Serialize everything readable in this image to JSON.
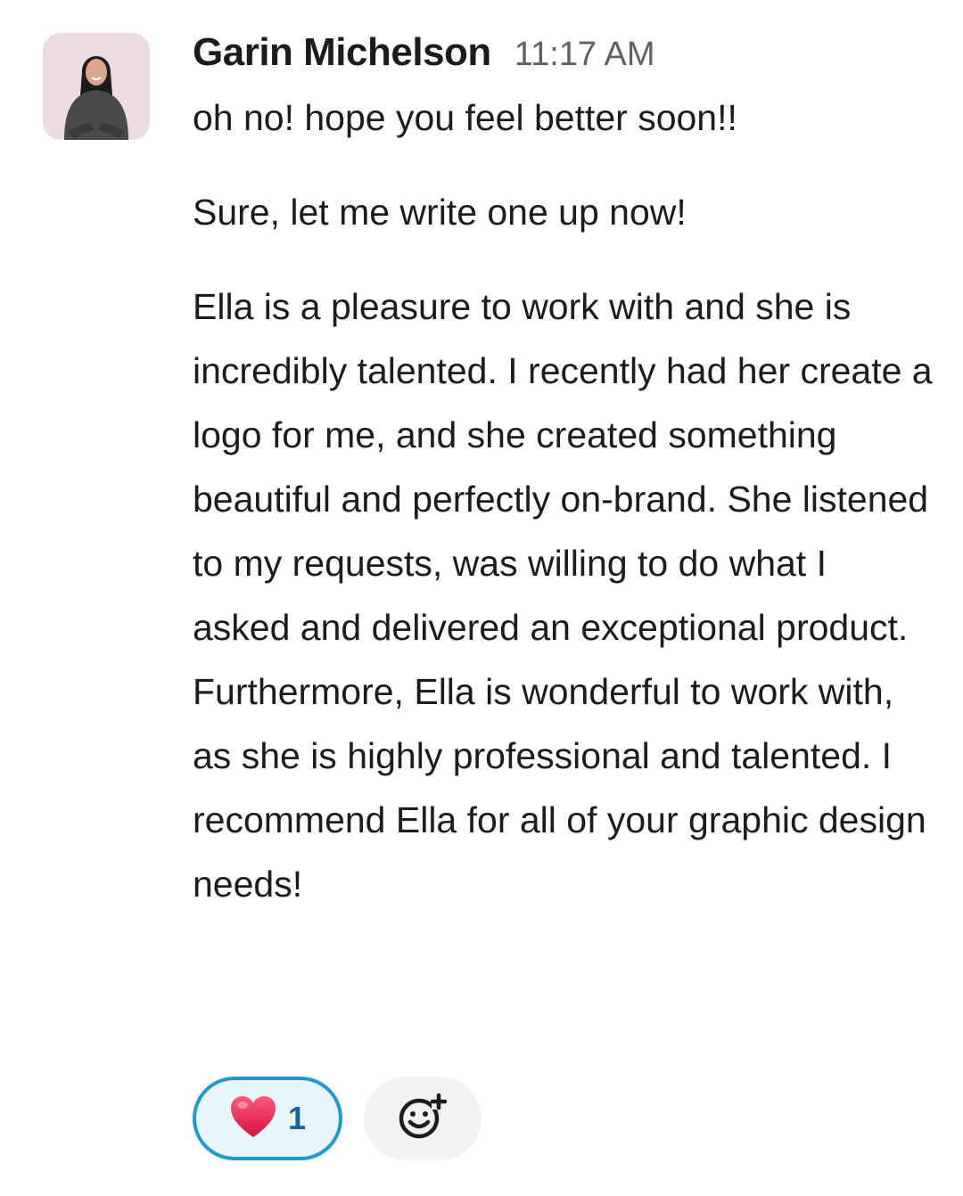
{
  "message": {
    "sender": "Garin Michelson",
    "timestamp": "11:17 AM",
    "paragraphs": [
      "oh no! hope you feel better soon!!",
      "Sure, let me write one up now!",
      "Ella is a pleasure to work with and she is incredibly talented. I recently had her create a logo for me, and she created something beautiful and perfectly on-brand. She listened to my requests, was willing to do what I asked and delivered an exceptional product. Furthermore, Ella is wonderful to work with, as she is highly professional and talented. I recommend Ella for all of your graphic design needs!"
    ]
  },
  "reactions": [
    {
      "emoji": "heart-emoji-icon",
      "count": "1"
    }
  ],
  "add_reaction": {
    "icon": "add-emoji-icon"
  },
  "colors": {
    "reaction_border": "#1d9bd1",
    "reaction_bg": "#e8f5fa",
    "reaction_count": "#1264a3",
    "heart": "#e0245e",
    "avatar_bg": "#ecdce0"
  }
}
